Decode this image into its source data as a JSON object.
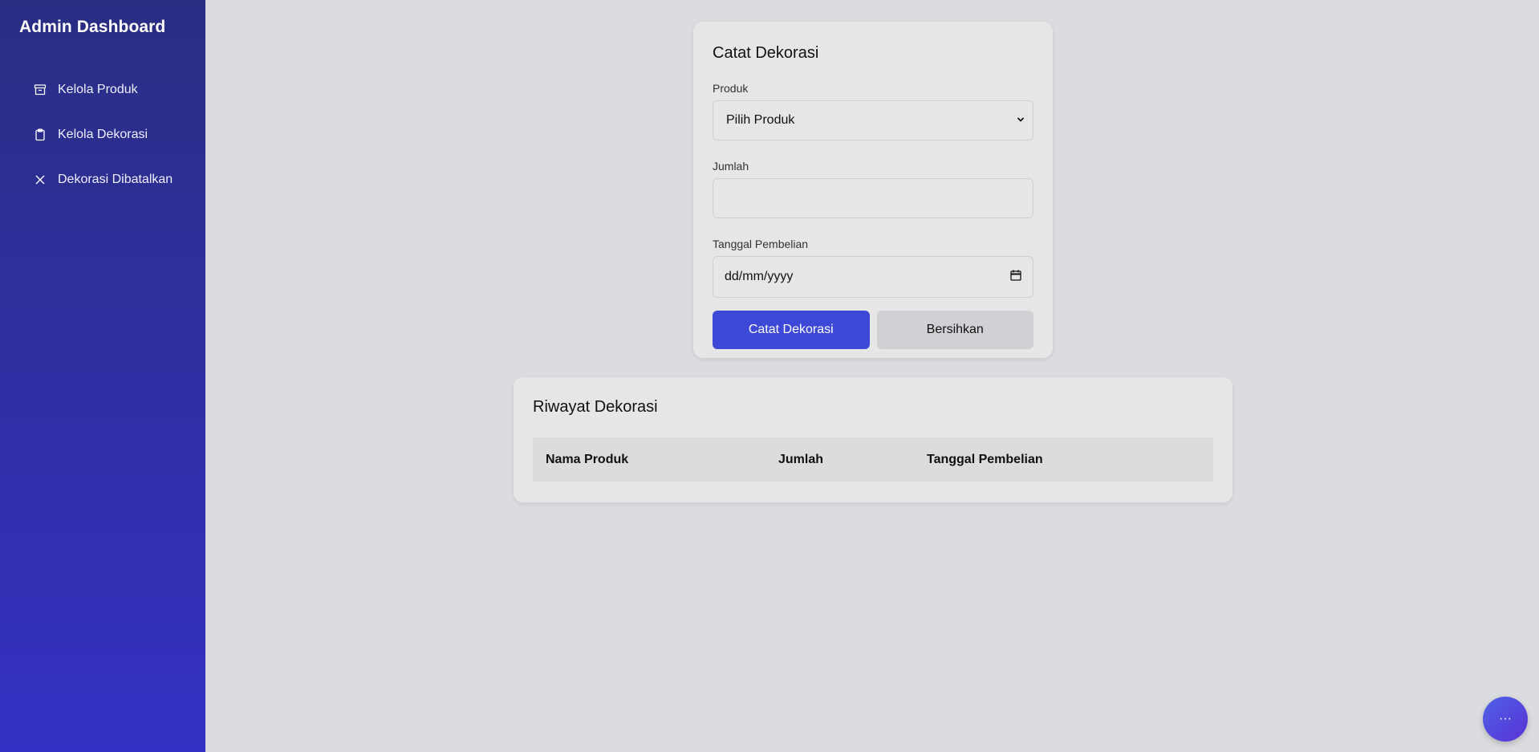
{
  "sidebar": {
    "brand": "Admin Dashboard",
    "items": [
      {
        "label": "Kelola Produk",
        "icon": "archive-icon"
      },
      {
        "label": "Kelola Dekorasi",
        "icon": "clipboard-icon"
      },
      {
        "label": "Dekorasi Dibatalkan",
        "icon": "close-icon"
      }
    ]
  },
  "form": {
    "title": "Catat Dekorasi",
    "produk_label": "Produk",
    "produk_value": "Pilih Produk",
    "jumlah_label": "Jumlah",
    "jumlah_value": "",
    "tanggal_label": "Tanggal Pembelian",
    "tanggal_value": "dd/mm/yyyy",
    "submit_label": "Catat Dekorasi",
    "clear_label": "Bersihkan"
  },
  "history": {
    "title": "Riwayat Dekorasi",
    "columns": [
      "Nama Produk",
      "Jumlah",
      "Tanggal Pembelian"
    ]
  },
  "fab": {
    "label": "···"
  },
  "colors": {
    "sidebar_top": "#2a2d82",
    "sidebar_bottom": "#3432c4",
    "primary": "#3d49d6",
    "background": "#dbdcdf"
  }
}
